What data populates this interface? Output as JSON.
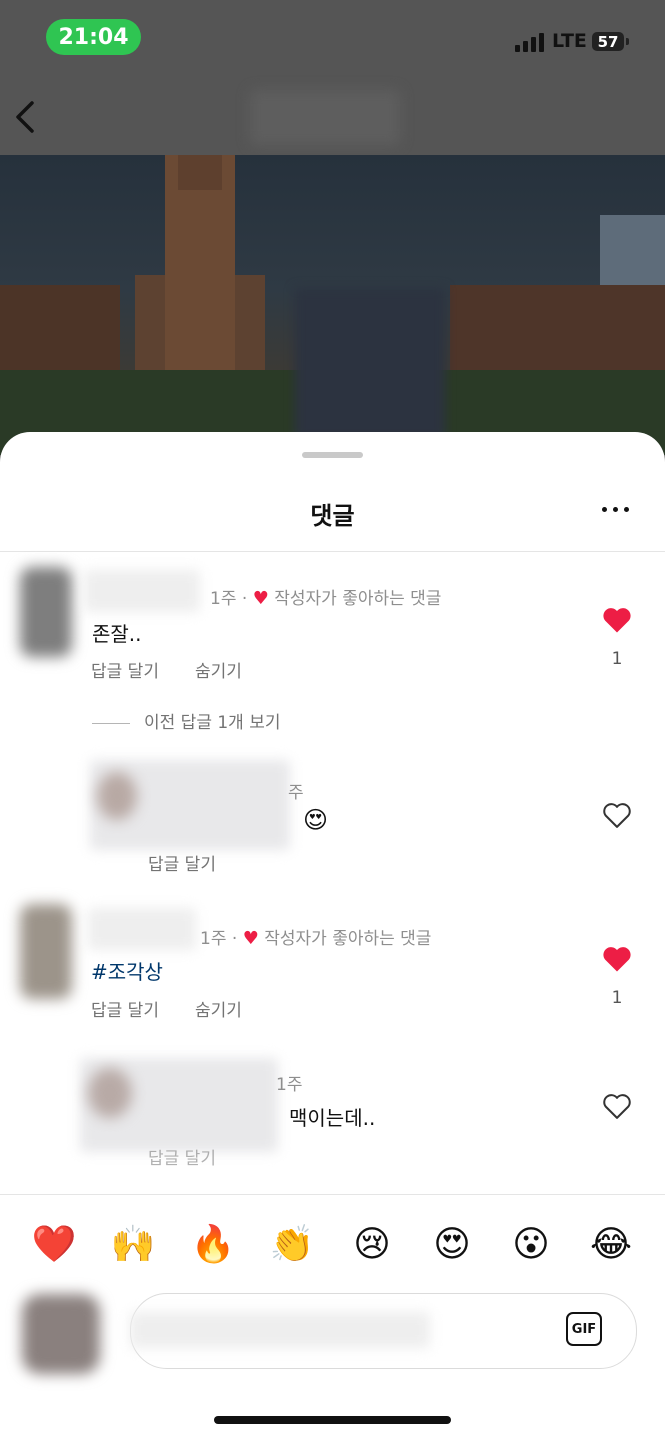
{
  "status_bar": {
    "time": "21:04",
    "network": "LTE",
    "battery": "57"
  },
  "sheet": {
    "title": "댓글"
  },
  "comments": [
    {
      "time": "1주",
      "dot": "·",
      "liked_label": "작성자가 좋아하는 댓글",
      "text": "존잘..",
      "reply": "답글 달기",
      "hide": "숨기기",
      "likes": "1"
    },
    {
      "time": "1주",
      "dot": "·",
      "liked_label": "작성자가 좋아하는 댓글",
      "text": "#조각상",
      "reply": "답글 달기",
      "hide": "숨기기",
      "likes": "1"
    }
  ],
  "replies": [
    {
      "time_fragment": "주",
      "text_emoji": "😍",
      "reply": "답글 달기"
    },
    {
      "time_fragment": "1주",
      "text": "맥이는데..",
      "reply": "답글 달기"
    }
  ],
  "view_previous": "이전 답글 1개 보기",
  "emojis": [
    "❤️",
    "🙌",
    "🔥",
    "👏",
    "😢",
    "😍",
    "😮",
    "😂"
  ],
  "input": {
    "gif_label": "GIF"
  },
  "colors": {
    "heart": "#ed1e45",
    "hashtag": "#00376b",
    "time_pill": "#2fc552"
  },
  "icons": [
    "back-icon",
    "more-icon",
    "heart-filled-icon",
    "heart-outline-icon",
    "gif-icon",
    "signal-icon",
    "battery-icon"
  ]
}
